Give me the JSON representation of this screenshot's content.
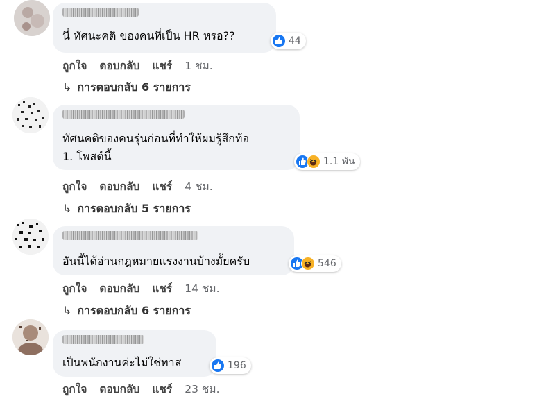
{
  "comments": [
    {
      "lines": [
        "นี่ ทัศนะคติ ของคนที่เป็น HR หรอ??"
      ],
      "reaction_count": "44",
      "reaction_types": [
        "like-icon"
      ],
      "actions": {
        "like": "ถูกใจ",
        "reply": "ตอบกลับ",
        "share": "แชร์",
        "time": "1 ชม."
      },
      "replies_label": "การตอบกลับ 6 รายการ"
    },
    {
      "lines": [
        "ทัศนคติของคนรุ่นก่อนที่ทำให้ผมรู้สึกท้อ",
        "1. โพสต์นี้"
      ],
      "reaction_count": "1.1 พัน",
      "reaction_types": [
        "like-icon",
        "haha-icon"
      ],
      "actions": {
        "like": "ถูกใจ",
        "reply": "ตอบกลับ",
        "share": "แชร์",
        "time": "4 ชม."
      },
      "replies_label": "การตอบกลับ 5 รายการ"
    },
    {
      "lines": [
        "อันนี้ได้อ่านกฎหมายแรงงานบ้างมั้ยครับ"
      ],
      "reaction_count": "546",
      "reaction_types": [
        "like-icon",
        "haha-icon"
      ],
      "actions": {
        "like": "ถูกใจ",
        "reply": "ตอบกลับ",
        "share": "แชร์",
        "time": "14 ชม."
      },
      "replies_label": "การตอบกลับ 6 รายการ"
    },
    {
      "lines": [
        "เป็นพนักงานค่ะไม่ใช่ทาส"
      ],
      "reaction_count": "196",
      "reaction_types": [
        "like-icon"
      ],
      "actions": {
        "like": "ถูกใจ",
        "reply": "ตอบกลับ",
        "share": "แชร์",
        "time": "23 ชม."
      }
    }
  ],
  "colors": {
    "bubble": "#f0f2f5",
    "like": "#1877f2",
    "haha": "#f7b125",
    "meta": "#65676b"
  }
}
